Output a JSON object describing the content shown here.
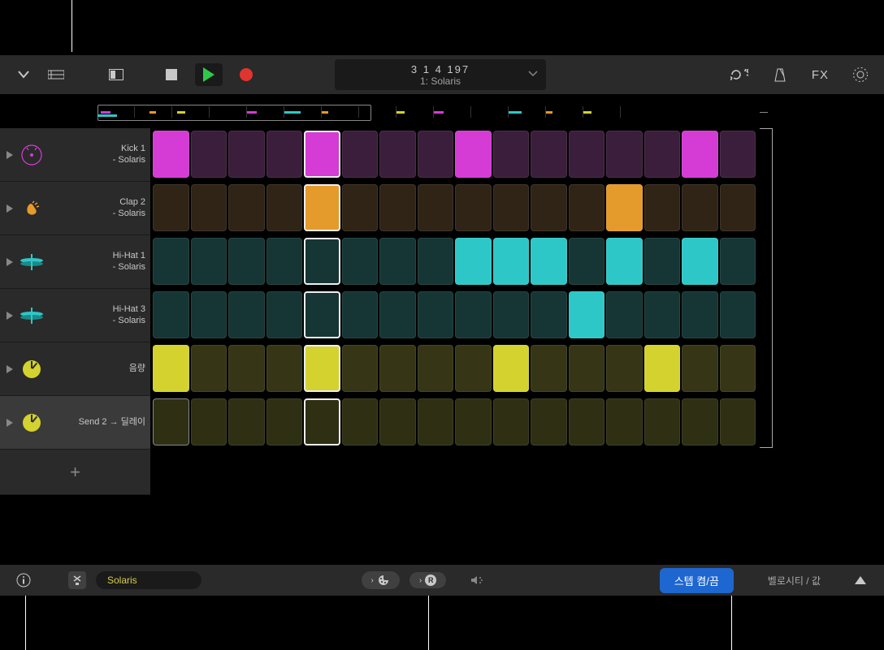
{
  "transport": {
    "position": "3  1  4  197",
    "pattern": "1: Solaris",
    "fx_label": "FX"
  },
  "rows": [
    {
      "name": "Kick 1 - Solaris",
      "icon": "kick",
      "color_on": "#d53bd5",
      "color_off": "#3b1e3b",
      "selected": false,
      "steps": [
        1,
        0,
        0,
        0,
        1,
        0,
        0,
        0,
        1,
        0,
        0,
        0,
        0,
        0,
        1,
        0
      ]
    },
    {
      "name": "Clap 2 - Solaris",
      "icon": "clap",
      "color_on": "#e59a2c",
      "color_off": "#2f2416",
      "selected": false,
      "steps": [
        0,
        0,
        0,
        0,
        1,
        0,
        0,
        0,
        0,
        0,
        0,
        0,
        1,
        0,
        0,
        0
      ]
    },
    {
      "name": "Hi-Hat 1 - Solaris",
      "icon": "hihat",
      "color_on": "#2ec7c7",
      "color_off": "#163636",
      "selected": false,
      "steps": [
        0,
        0,
        0,
        0,
        0,
        0,
        0,
        0,
        1,
        1,
        1,
        0,
        1,
        0,
        1,
        0
      ]
    },
    {
      "name": "Hi-Hat 3 - Solaris",
      "icon": "hihat",
      "color_on": "#2ec7c7",
      "color_off": "#163636",
      "selected": false,
      "steps": [
        0,
        0,
        0,
        0,
        0,
        0,
        0,
        0,
        0,
        0,
        0,
        1,
        0,
        0,
        0,
        0
      ]
    },
    {
      "name": "음량",
      "icon": "knob",
      "color_on": "#d4d22e",
      "color_off": "#363616",
      "selected": false,
      "steps": [
        1,
        0,
        0,
        0,
        1,
        0,
        0,
        0,
        0,
        1,
        0,
        0,
        0,
        1,
        0,
        0
      ]
    },
    {
      "name": "Send 2 → 딜레이",
      "icon": "knob",
      "color_on": "#d4d22e",
      "color_off": "#2f2f14",
      "selected": true,
      "steps": [
        0,
        0,
        0,
        0,
        0,
        0,
        0,
        0,
        0,
        0,
        0,
        0,
        0,
        0,
        0,
        0
      ]
    }
  ],
  "playhead_step": 4,
  "footer": {
    "pattern_name": "Solaris",
    "step_toggle": "스텝 켬/끔",
    "edit_mode": "벨로시티 / 값",
    "r_label": "R"
  },
  "ruler_colors": [
    "#d53bd5",
    "#e59a2c",
    "#2ec7c7",
    "#d4d22e"
  ]
}
